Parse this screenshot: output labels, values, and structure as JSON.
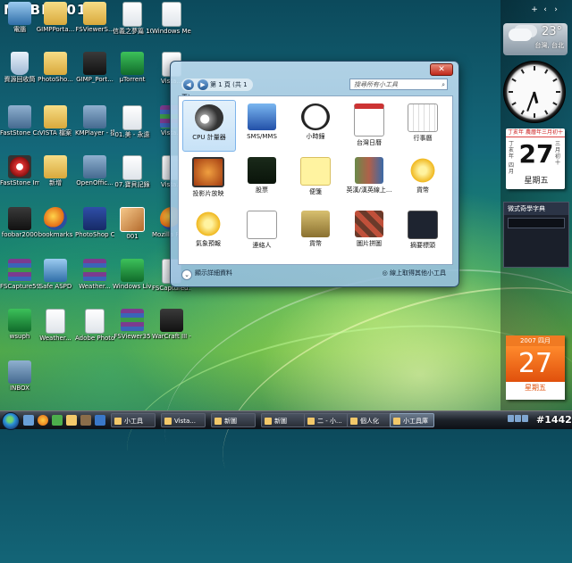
{
  "watermark": {
    "text": "MOBILE01"
  },
  "desktop_icons": [
    {
      "label": "電腦",
      "kind": "computer"
    },
    {
      "label": "GIMPPorta...",
      "kind": "folder"
    },
    {
      "label": "FSViewerS...",
      "kind": "folder"
    },
    {
      "label": "信義之夢篇 102D版.w3x",
      "kind": "doc"
    },
    {
      "label": "Windows Media Ce...",
      "kind": "doc"
    },
    {
      "label": "資源回收筒",
      "kind": "recycle"
    },
    {
      "label": "PhotoSho...",
      "kind": "folder"
    },
    {
      "label": "GIMP_Port...",
      "kind": "dark"
    },
    {
      "label": "µTorrent",
      "kind": "green"
    },
    {
      "label": "Vista...",
      "kind": "doc"
    },
    {
      "label": "FastStone Capture",
      "kind": "wrench"
    },
    {
      "label": "VISTA 檔案",
      "kind": "folder"
    },
    {
      "label": "KMPlayer - 捷徑",
      "kind": "wrench"
    },
    {
      "label": "01.美 - 永遠",
      "kind": "doc"
    },
    {
      "label": "Vista...",
      "kind": "rar"
    },
    {
      "label": "FastStone Image...",
      "kind": "eye"
    },
    {
      "label": "新增",
      "kind": "folder"
    },
    {
      "label": "OpenOffic...",
      "kind": "wrench"
    },
    {
      "label": "07.寶貝記錄",
      "kind": "doc"
    },
    {
      "label": "Vista...",
      "kind": "doc"
    },
    {
      "label": "foobar2000",
      "kind": "dark"
    },
    {
      "label": "bookmarks",
      "kind": "ff"
    },
    {
      "label": "PhotoShop CS Portable",
      "kind": "ps"
    },
    {
      "label": "001",
      "kind": "photo"
    },
    {
      "label": "Mozilla Firefox",
      "kind": "ff"
    },
    {
      "label": "FSCapture59",
      "kind": "rar"
    },
    {
      "label": "Safe ASPD",
      "kind": "computer"
    },
    {
      "label": "Weather...",
      "kind": "rar"
    },
    {
      "label": "Windows Live Mes...",
      "kind": "green"
    },
    {
      "label": "FSCaptured...",
      "kind": "doc"
    },
    {
      "label": "wsuph",
      "kind": "green"
    },
    {
      "label": "Weather...",
      "kind": "doc"
    },
    {
      "label": "Adobe Photoshop...",
      "kind": "doc"
    },
    {
      "label": "FSViewer35",
      "kind": "rar"
    },
    {
      "label": "WarCraft III - 捷徑",
      "kind": "dark"
    },
    {
      "label": "INBOX",
      "kind": "wrench"
    }
  ],
  "sidebar": {
    "controls": [
      "+",
      "‹",
      "›"
    ],
    "weather": {
      "temp": "23°",
      "city": "台灣, 台北"
    },
    "calendar": {
      "year_text": "丁亥年 農曆年三月初十",
      "left_text": "丁亥年",
      "right_text": "三月初十",
      "month_text": "四月",
      "day": "27",
      "weekday": "星期五"
    },
    "dictionary": {
      "title": "微式奇學字典"
    },
    "calendar2": {
      "header": "2007 四月",
      "day": "27",
      "weekday": "星期五"
    }
  },
  "gallery": {
    "close_label": "✕",
    "page_label": "第 1 頁 (共 1 頁)",
    "prev_label": "◀",
    "next_label": "▶",
    "search_placeholder": "搜尋所有小工具",
    "search_icon": "search-icon",
    "gadgets": [
      {
        "label": "CPU 計量器",
        "kind": "cpu",
        "selected": true
      },
      {
        "label": "SMS/MMS",
        "kind": "sms",
        "selected": false
      },
      {
        "label": "小時鐘",
        "kind": "clock",
        "selected": false
      },
      {
        "label": "台灣日曆",
        "kind": "calendar",
        "selected": false
      },
      {
        "label": "行事曆",
        "kind": "schedule",
        "selected": false
      },
      {
        "label": "投影片放映",
        "kind": "slideshow",
        "selected": false
      },
      {
        "label": "股票",
        "kind": "stocks",
        "selected": false
      },
      {
        "label": "便箋",
        "kind": "notes",
        "selected": false
      },
      {
        "label": "英漢/漢英線上...",
        "kind": "dictionary",
        "selected": false
      },
      {
        "label": "貨幣",
        "kind": "weather",
        "selected": false
      },
      {
        "label": "氣象預報",
        "kind": "sun",
        "selected": false
      },
      {
        "label": "連絡人",
        "kind": "contacts",
        "selected": false
      },
      {
        "label": "貨幣",
        "kind": "currency",
        "selected": false
      },
      {
        "label": "圖片拼圖",
        "kind": "puzzle",
        "selected": false
      },
      {
        "label": "摘要標頭",
        "kind": "feed",
        "selected": false
      }
    ],
    "details_label": "顯示詳細資料",
    "online_label": "線上取得其他小工具"
  },
  "taskbar": {
    "buttons": [
      {
        "label": "小工具",
        "active": false
      },
      {
        "label": "Vista...",
        "active": false
      },
      {
        "label": "新圖",
        "active": false
      },
      {
        "label": "新圖",
        "active": false
      },
      {
        "label": "二 - 小...",
        "active": false
      },
      {
        "label": "個人化",
        "active": false
      },
      {
        "label": "小工具庫",
        "active": true
      }
    ],
    "count_label": "#1442"
  }
}
